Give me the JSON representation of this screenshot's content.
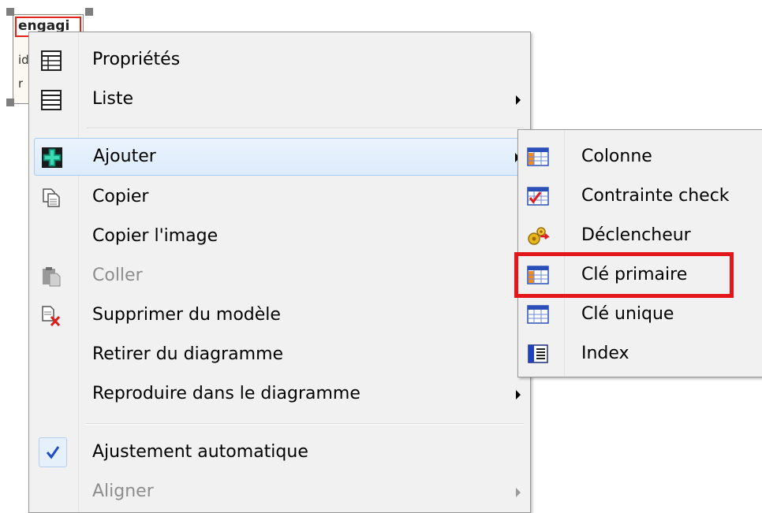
{
  "entity": {
    "title": "engagi",
    "lines": [
      "id",
      "r"
    ]
  },
  "menu": {
    "items": [
      {
        "label": "Propriétés",
        "icon": "properties-table-icon",
        "disabled": false,
        "submenu": false
      },
      {
        "label": "Liste",
        "icon": "list-icon",
        "disabled": false,
        "submenu": true
      },
      {
        "label": "Ajouter",
        "icon": "add-plus-icon",
        "disabled": false,
        "submenu": true,
        "hover": true
      },
      {
        "label": "Copier",
        "icon": "copy-icon",
        "disabled": false,
        "submenu": false
      },
      {
        "label": "Copier l'image",
        "icon": "",
        "disabled": false,
        "submenu": false
      },
      {
        "label": "Coller",
        "icon": "paste-icon",
        "disabled": true,
        "submenu": false
      },
      {
        "label": "Supprimer du modèle",
        "icon": "delete-icon",
        "disabled": false,
        "submenu": false
      },
      {
        "label": "Retirer du diagramme",
        "icon": "",
        "disabled": false,
        "submenu": false
      },
      {
        "label": "Reproduire dans le diagramme",
        "icon": "",
        "disabled": false,
        "submenu": true
      },
      {
        "label": "Ajustement automatique",
        "icon": "checkmark-icon",
        "disabled": false,
        "submenu": false,
        "checked": true
      },
      {
        "label": "Aligner",
        "icon": "",
        "disabled": true,
        "submenu": true
      }
    ]
  },
  "submenu": {
    "items": [
      {
        "label": "Colonne",
        "icon": "column-icon"
      },
      {
        "label": "Contrainte check",
        "icon": "check-constraint-icon"
      },
      {
        "label": "Déclencheur",
        "icon": "trigger-icon"
      },
      {
        "label": "Clé primaire",
        "icon": "primary-key-icon",
        "highlighted": true
      },
      {
        "label": "Clé unique",
        "icon": "unique-key-icon"
      },
      {
        "label": "Index",
        "icon": "index-icon"
      }
    ]
  },
  "colors": {
    "highlight": "#e3161c",
    "hover_border": "#a8cbf1",
    "check": "#1f4ec4"
  }
}
